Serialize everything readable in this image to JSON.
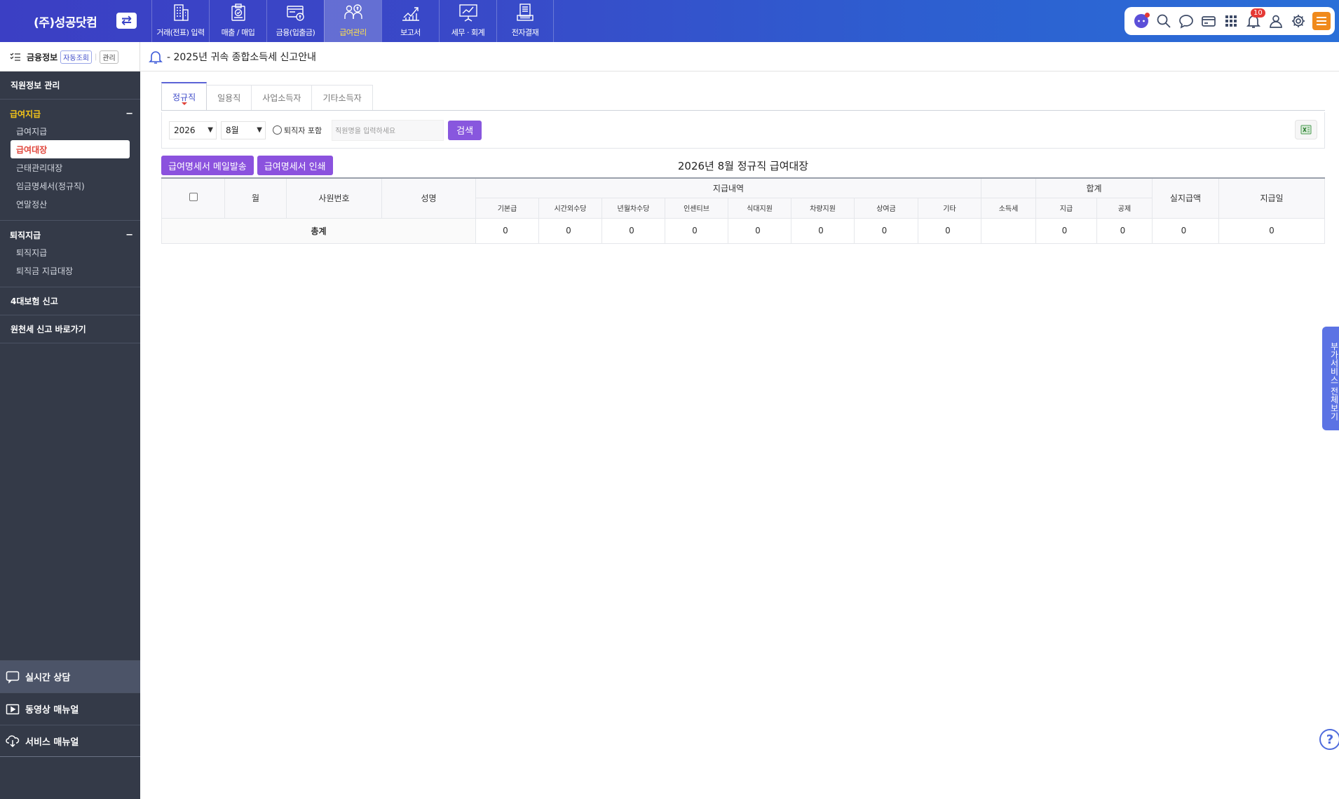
{
  "brand": "(주)성공닷컴",
  "nav": [
    {
      "label": "거래(전표) 입력",
      "icon": "building-icon",
      "active": false
    },
    {
      "label": "매출 / 매입",
      "icon": "clipboard-check-icon",
      "active": false
    },
    {
      "label": "금융(입출금)",
      "icon": "card-coin-icon",
      "active": false
    },
    {
      "label": "급여관리",
      "icon": "payroll-people-icon",
      "active": true
    },
    {
      "label": "보고서",
      "icon": "chart-growth-icon",
      "active": false
    },
    {
      "label": "세무 · 회계",
      "icon": "presentation-chart-icon",
      "active": false
    },
    {
      "label": "전자결재",
      "icon": "document-stack-icon",
      "active": false
    }
  ],
  "util": {
    "notification_count": "10"
  },
  "subhead": {
    "finance_title": "금융정보",
    "auto_query": "자동조회",
    "manage": "관리",
    "notice": "- 2025년 귀속 종합소득세 신고안내"
  },
  "sidebar": {
    "employee_info": "직원정보 관리",
    "salary_group": {
      "title": "급여지급",
      "items": [
        "급여지급",
        "급여대장",
        "근태관리대장",
        "임금명세서(정규직)",
        "연말정산"
      ]
    },
    "retire_group": {
      "title": "퇴직지급",
      "items": [
        "퇴직지급",
        "퇴직금 지급대장"
      ]
    },
    "insurance": "4대보험 신고",
    "withholding": "원천세 신고 바로가기",
    "live_chat": "실시간 상담",
    "video_manual": "동영상 매뉴얼",
    "service_manual": "서비스 매뉴얼"
  },
  "tabs": [
    "정규직",
    "일용직",
    "사업소득자",
    "기타소득자"
  ],
  "filters": {
    "year": "2026",
    "month": "8월",
    "include_retired": "퇴직자 포함",
    "search_placeholder": "직원명을 입력하세요",
    "search_button": "검색"
  },
  "actions": {
    "mail": "급여명세서 메일발송",
    "print": "급여명세서 인쇄"
  },
  "table": {
    "title": "2026년 8월 정규직 급여대장",
    "headers": {
      "month": "월",
      "emp_no": "사원번호",
      "name": "성명",
      "pay_details": "지급내역",
      "total": "합계",
      "net_pay": "실지급액",
      "pay_date": "지급일"
    },
    "sub_headers": [
      "기본급",
      "시간외수당",
      "년월차수당",
      "인센티브",
      "식대지원",
      "차량지원",
      "상여금",
      "기타",
      "소득세",
      "지급",
      "공제"
    ],
    "total_row": {
      "label": "총계",
      "values": [
        "0",
        "0",
        "0",
        "0",
        "0",
        "0",
        "0",
        "0",
        "",
        "0",
        "0",
        "0",
        "0"
      ]
    }
  },
  "side_tab": "부가서비스 전체보기",
  "colors": {
    "topbar": "#3b45c8",
    "sidebar": "#343a48",
    "accent_purple": "#8b52de",
    "active_nav_text": "#ffe14d"
  }
}
